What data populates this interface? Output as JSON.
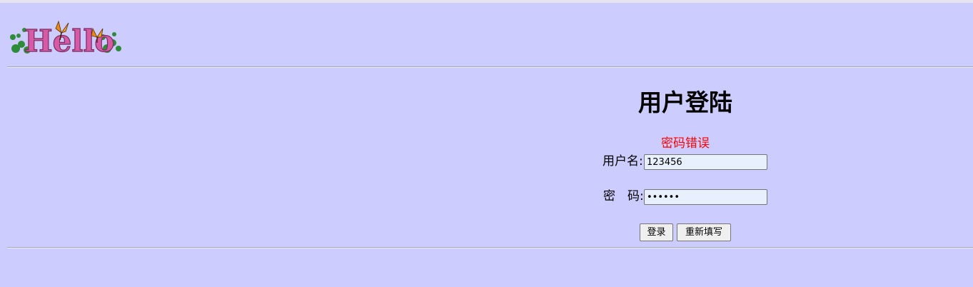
{
  "logo": {
    "text": "Hello",
    "icon": "hello-logo-with-butterflies"
  },
  "login": {
    "heading": "用户登陆",
    "error_message": "密码错误",
    "username_label": "用户名:",
    "username_value": "123456",
    "password_label": "密　码:",
    "password_value": "123456",
    "submit_label": "登录",
    "reset_label": "重新填写"
  },
  "colors": {
    "background": "#ccccff",
    "error": "#ff0000"
  }
}
